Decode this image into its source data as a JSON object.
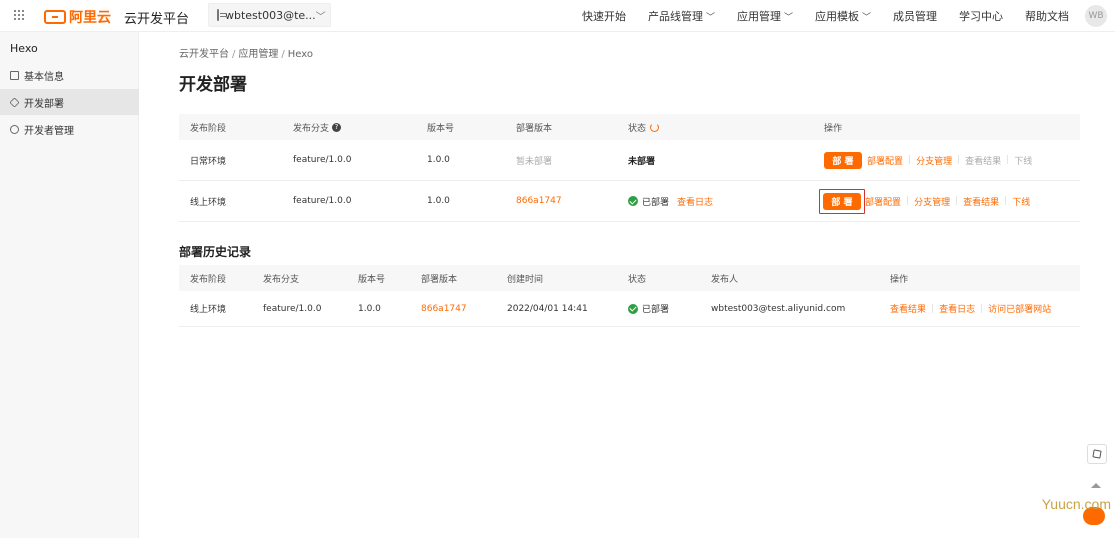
{
  "header": {
    "logo_text": "阿里云",
    "platform_title": "云开发平台",
    "account": "wbtest003@te...",
    "nav": [
      "快速开始",
      "产品线管理",
      "应用管理",
      "应用模板",
      "成员管理",
      "学习中心",
      "帮助文档"
    ],
    "avatar": "WB"
  },
  "sidebar": {
    "app_name": "Hexo",
    "items": [
      "基本信息",
      "开发部署",
      "开发者管理"
    ],
    "active": "开发部署"
  },
  "breadcrumb": [
    "云开发平台",
    "应用管理",
    "Hexo"
  ],
  "page_title": "开发部署",
  "deploy_table": {
    "headers": [
      "发布阶段",
      "发布分支",
      "版本号",
      "部署版本",
      "状态",
      "操作"
    ],
    "rows": [
      {
        "stage": "日常环境",
        "branch": "feature/1.0.0",
        "version": "1.0.0",
        "deploy_version": "暂未部署",
        "status": "未部署",
        "deploy_btn": "部 署",
        "ops": [
          "部署配置",
          "分支管理",
          "查看结果",
          "下线"
        ]
      },
      {
        "stage": "线上环境",
        "branch": "feature/1.0.0",
        "version": "1.0.0",
        "deploy_version": "866a1747",
        "status": "已部署",
        "log_link": "查看日志",
        "deploy_btn": "部 署",
        "ops": [
          "部署配置",
          "分支管理",
          "查看结果",
          "下线"
        ]
      }
    ]
  },
  "history": {
    "title": "部署历史记录",
    "headers": [
      "发布阶段",
      "发布分支",
      "版本号",
      "部署版本",
      "创建时间",
      "状态",
      "发布人",
      "操作"
    ],
    "rows": [
      {
        "stage": "线上环境",
        "branch": "feature/1.0.0",
        "version": "1.0.0",
        "deploy_version": "866a1747",
        "created": "2022/04/01 14:41",
        "status": "已部署",
        "publisher": "wbtest003@test.aliyunid.com",
        "ops": [
          "查看结果",
          "查看日志",
          "访问已部署网站"
        ]
      }
    ]
  },
  "watermark": "Yuucn.com"
}
